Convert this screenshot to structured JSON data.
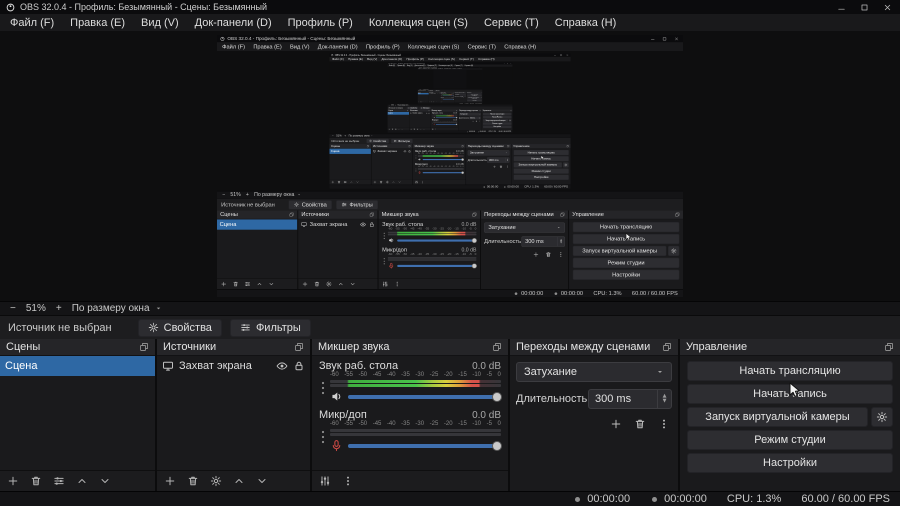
{
  "window": {
    "title": "OBS 32.0.4 - Профиль: Безымянный - Сцены: Безымянный"
  },
  "menu": {
    "items": [
      "Файл (F)",
      "Правка (E)",
      "Вид (V)",
      "Док-панели (D)",
      "Профиль (P)",
      "Коллекция сцен (S)",
      "Сервис (T)",
      "Справка (H)"
    ]
  },
  "zoom": {
    "out": "−",
    "level": "51%",
    "in": "+",
    "fit": "По размеру окна"
  },
  "source_toolbar": {
    "message": "Источник не выбран",
    "properties": "Свойства",
    "filters": "Фильтры"
  },
  "scenes": {
    "title": "Сцены",
    "rows": [
      {
        "name": "Сцена"
      }
    ]
  },
  "sources": {
    "title": "Источники",
    "rows": [
      {
        "name": "Захват экрана"
      }
    ]
  },
  "mixer": {
    "title": "Микшер звука",
    "ticks": [
      "-60",
      "-55",
      "-50",
      "-45",
      "-40",
      "-35",
      "-30",
      "-25",
      "-20",
      "-15",
      "-10",
      "-5",
      "0"
    ],
    "channels": [
      {
        "name": "Звук раб. стола",
        "db": "0.0 dB"
      },
      {
        "name": "Микр/доп",
        "db": "0.0 dB"
      }
    ]
  },
  "transitions": {
    "title": "Переходы между сценами",
    "selected": "Затухание",
    "duration_label": "Длительность",
    "duration": "300 ms"
  },
  "controls": {
    "title": "Управление",
    "stream": "Начать трансляцию",
    "record": "Начать запись",
    "vcam": "Запуск виртуальной камеры",
    "studio": "Режим студии",
    "settings": "Настройки"
  },
  "statusbar": {
    "stream_time": "00:00:00",
    "rec_time": "00:00:00",
    "cpu": "CPU: 1.3%",
    "fps": "60.00 / 60.00 FPS"
  },
  "colors": {
    "accent": "#2e68a4",
    "meter_green": "#49c24a",
    "meter_yellow": "#d8ce3e",
    "meter_red": "#d5524a"
  }
}
